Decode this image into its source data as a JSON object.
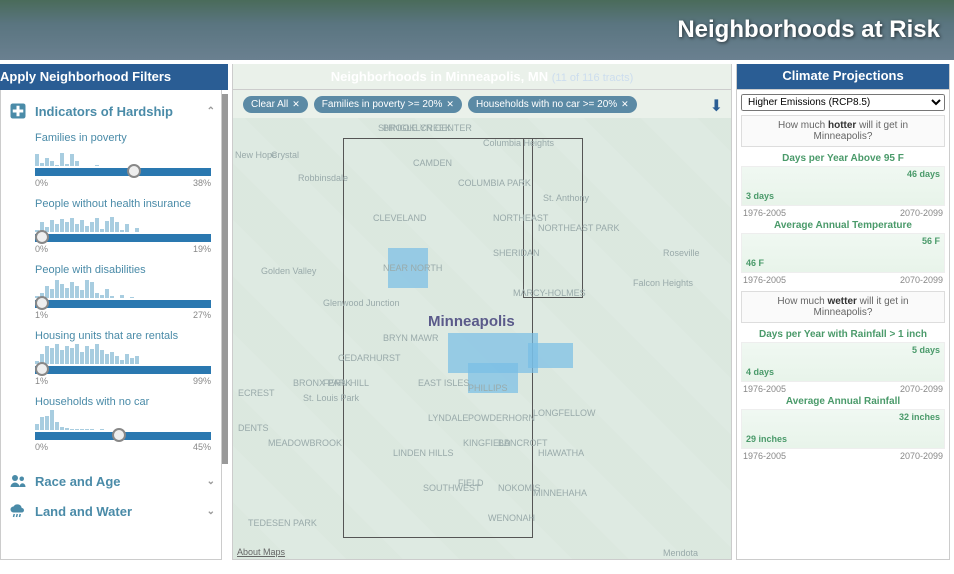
{
  "banner": {
    "title": "Neighborhoods at Risk"
  },
  "headers": {
    "left": "Apply Neighborhood Filters",
    "mid_prefix": "Neighborhoods in Minneapolis, MN",
    "mid_sub": "(11 of 116 tracts)",
    "right": "Climate Projections"
  },
  "sections": {
    "hardship": "Indicators of Hardship",
    "race": "Race and Age",
    "land": "Land and Water"
  },
  "indicators": [
    {
      "label": "Families in poverty",
      "min": "0%",
      "max": "38%",
      "thumb_pct": 52,
      "bars": [
        12,
        3,
        8,
        5,
        1,
        13,
        2,
        12,
        5,
        0,
        0,
        0,
        1,
        0,
        0,
        0,
        0,
        0,
        0,
        0,
        0
      ]
    },
    {
      "label": "People without health insurance",
      "min": "0%",
      "max": "19%",
      "thumb_pct": 0,
      "bars": [
        2,
        10,
        5,
        12,
        8,
        13,
        10,
        14,
        8,
        12,
        6,
        10,
        14,
        3,
        11,
        15,
        10,
        2,
        8,
        0,
        4
      ]
    },
    {
      "label": "People with disabilities",
      "min": "1%",
      "max": "27%",
      "thumb_pct": 0,
      "bars": [
        2,
        5,
        12,
        9,
        18,
        14,
        10,
        16,
        12,
        8,
        18,
        16,
        5,
        3,
        9,
        2,
        0,
        3,
        0,
        1,
        0
      ]
    },
    {
      "label": "Housing units that are rentals",
      "min": "1%",
      "max": "99%",
      "thumb_pct": 0,
      "bars": [
        3,
        10,
        18,
        16,
        20,
        14,
        18,
        16,
        20,
        12,
        18,
        15,
        20,
        14,
        10,
        12,
        8,
        4,
        10,
        6,
        8
      ]
    },
    {
      "label": "Households with no car",
      "min": "0%",
      "max": "45%",
      "thumb_pct": 44,
      "bars": [
        6,
        13,
        14,
        20,
        8,
        3,
        2,
        1,
        1,
        1,
        1,
        1,
        0,
        1,
        0,
        0,
        0,
        0,
        0,
        0,
        0
      ]
    }
  ],
  "chips": {
    "clear": "Clear All",
    "c1": "Families in poverty >= 20%",
    "c2": "Households with no car >= 20%"
  },
  "map": {
    "city_label": "Minneapolis",
    "about_link": "About Maps",
    "labels": [
      "BROOKLYN CENTER",
      "Crystal",
      "New Hope",
      "Robbinsdale",
      "Golden Valley",
      "CLEVELAND",
      "CAMDEN",
      "COLUMBIA PARK",
      "Columbia Heights",
      "NORTHEAST",
      "NORTHEAST PARK",
      "SHERIDAN",
      "NEAR NORTH",
      "St. Anthony",
      "MARCY-HOLMES",
      "Falcon Heights",
      "Roseville",
      "BRYN MAWR",
      "CEDARHURST",
      "EAST ISLES",
      "PHILLIPS",
      "LYNDALE",
      "POWDERHORN",
      "LONGFELLOW",
      "KINGFIELD",
      "BANCROFT",
      "HIAWATHA",
      "LINDEN HILLS",
      "SOUTHWEST",
      "FIELD",
      "NOKOMIS",
      "MINNEHAHA",
      "SHINGLE CREEK",
      "WENONAH",
      "MEADOWBROOK",
      "St. Louis Park",
      "BRONX PARK",
      "FERN HILL",
      "ECREST",
      "DENTS",
      "TEDESEN PARK",
      "Mendota",
      "Glenwood Junction"
    ]
  },
  "climate": {
    "dropdown": "Higher Emissions (RCP8.5)",
    "q_hot_pre": "How much ",
    "q_hot_bold": "hotter",
    "q_hot_post": " will it get in Minneapolis?",
    "q_wet_pre": "How much ",
    "q_wet_bold": "wetter",
    "q_wet_post": " will it get in Minneapolis?",
    "charts": [
      {
        "title": "Days per Year Above 95 F",
        "left_val": "3 days",
        "right_val": "46 days",
        "range_l": "1976-2005",
        "range_r": "2070-2099"
      },
      {
        "title": "Average Annual Temperature",
        "left_val": "46 F",
        "right_val": "56 F",
        "range_l": "1976-2005",
        "range_r": "2070-2099"
      },
      {
        "title": "Days per Year with Rainfall > 1 inch",
        "left_val": "4 days",
        "right_val": "5 days",
        "range_l": "1976-2005",
        "range_r": "2070-2099"
      },
      {
        "title": "Average Annual Rainfall",
        "left_val": "29 inches",
        "right_val": "32 inches",
        "range_l": "1976-2005",
        "range_r": "2070-2099"
      }
    ]
  },
  "chart_data": [
    {
      "type": "line",
      "title": "Days per Year Above 95 F",
      "x": [
        "1976-2005",
        "2070-2099"
      ],
      "values": [
        3,
        46
      ],
      "ylabel": "days"
    },
    {
      "type": "line",
      "title": "Average Annual Temperature",
      "x": [
        "1976-2005",
        "2070-2099"
      ],
      "values": [
        46,
        56
      ],
      "ylabel": "°F"
    },
    {
      "type": "line",
      "title": "Days per Year with Rainfall > 1 inch",
      "x": [
        "1976-2005",
        "2070-2099"
      ],
      "values": [
        4,
        5
      ],
      "ylabel": "days"
    },
    {
      "type": "line",
      "title": "Average Annual Rainfall",
      "x": [
        "1976-2005",
        "2070-2099"
      ],
      "values": [
        29,
        32
      ],
      "ylabel": "inches"
    }
  ]
}
